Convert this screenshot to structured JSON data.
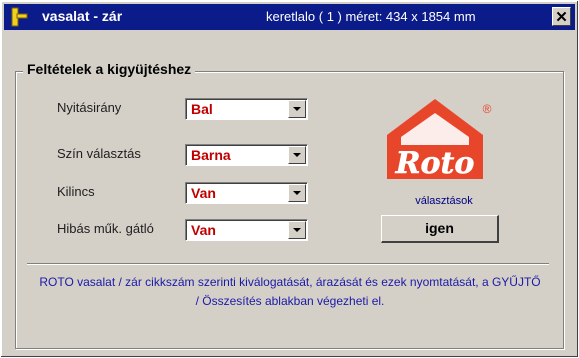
{
  "window": {
    "title": "vasalat - zár",
    "info": "keretlalo ( 1 ) méret: 434 x 1854 mm",
    "close_label": "✕"
  },
  "group": {
    "title": "Feltételek a kigyüjtéshez"
  },
  "fields": [
    {
      "label": "Nyitásirány",
      "value": "Bal"
    },
    {
      "label": "Szín választás",
      "value": "Barna"
    },
    {
      "label": "Kilincs",
      "value": "Van"
    },
    {
      "label": "Hibás műk. gátló",
      "value": "Van"
    }
  ],
  "logo": {
    "text": "Roto",
    "mark": "®",
    "color": "#e8462a"
  },
  "choices": {
    "label": "választások",
    "button": "igen"
  },
  "info_text": "ROTO vasalat / zár cikkszám szerinti  kiválogatását, árazását és ezek nyomtatását,  a GYŰJTŐ / Összesítés ablakban végezheti el."
}
